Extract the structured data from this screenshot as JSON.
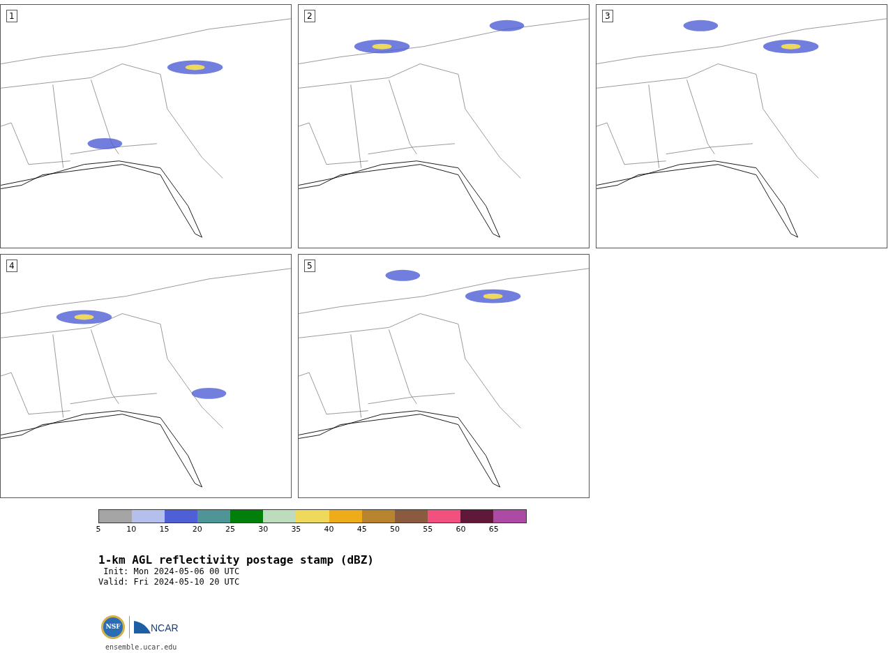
{
  "panels": [
    {
      "label": "1"
    },
    {
      "label": "2"
    },
    {
      "label": "3"
    },
    {
      "label": "4"
    },
    {
      "label": "5"
    }
  ],
  "colorbar": {
    "segments": [
      {
        "color": "#a5a5a5"
      },
      {
        "color": "#b5bfeb"
      },
      {
        "color": "#4f5fd5"
      },
      {
        "color": "#4f9598"
      },
      {
        "color": "#00800a"
      },
      {
        "color": "#bddcbd"
      },
      {
        "color": "#efd95c"
      },
      {
        "color": "#eeac1b"
      },
      {
        "color": "#b9842f"
      },
      {
        "color": "#8a5b3e"
      },
      {
        "color": "#f2517f"
      },
      {
        "color": "#5f1837"
      },
      {
        "color": "#ac4aa6"
      }
    ],
    "ticks": [
      "5",
      "10",
      "15",
      "20",
      "25",
      "30",
      "35",
      "40",
      "45",
      "50",
      "55",
      "60",
      "65"
    ]
  },
  "title": "1-km AGL reflectivity postage stamp (dBZ)",
  "init": " Init: Mon 2024-05-06 00 UTC",
  "valid": "Valid: Fri 2024-05-10 20 UTC",
  "logo": {
    "left": "NSF",
    "right": "NCAR"
  },
  "url": "ensemble.ucar.edu"
}
